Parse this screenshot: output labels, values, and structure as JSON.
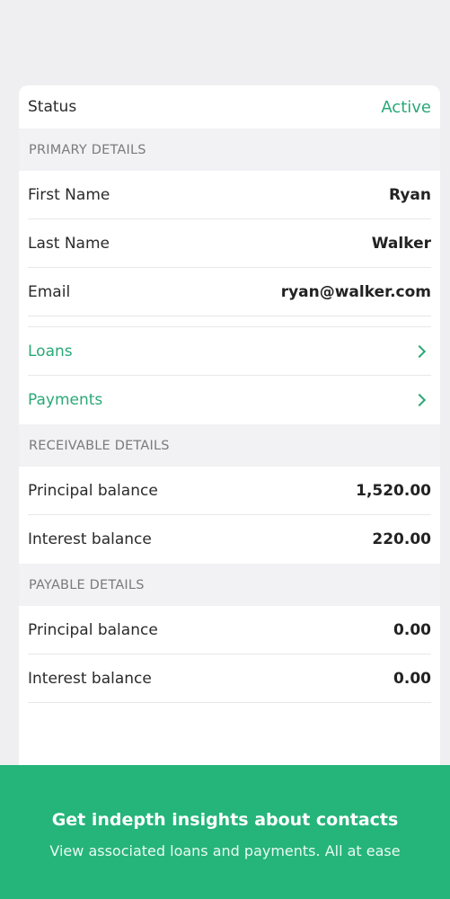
{
  "status": {
    "label": "Status",
    "value": "Active"
  },
  "primary": {
    "header": "PRIMARY DETAILS",
    "rows": [
      {
        "label": "First Name",
        "value": "Ryan"
      },
      {
        "label": "Last Name",
        "value": "Walker"
      },
      {
        "label": "Email",
        "value": "ryan@walker.com"
      }
    ]
  },
  "links": [
    {
      "label": "Loans",
      "icon": "chevron-right-icon"
    },
    {
      "label": "Payments",
      "icon": "chevron-right-icon"
    }
  ],
  "receivable": {
    "header": "RECEIVABLE DETAILS",
    "rows": [
      {
        "label": "Principal balance",
        "value": "1,520.00"
      },
      {
        "label": "Interest balance",
        "value": "220.00"
      }
    ]
  },
  "payable": {
    "header": "PAYABLE DETAILS",
    "rows": [
      {
        "label": "Principal balance",
        "value": "0.00"
      },
      {
        "label": "Interest balance",
        "value": "0.00"
      }
    ]
  },
  "banner": {
    "title": "Get indepth insights about contacts",
    "subtitle": "View associated loans and payments. All at ease"
  },
  "colors": {
    "accent": "#2aa877",
    "banner_bg": "#25b47a"
  }
}
